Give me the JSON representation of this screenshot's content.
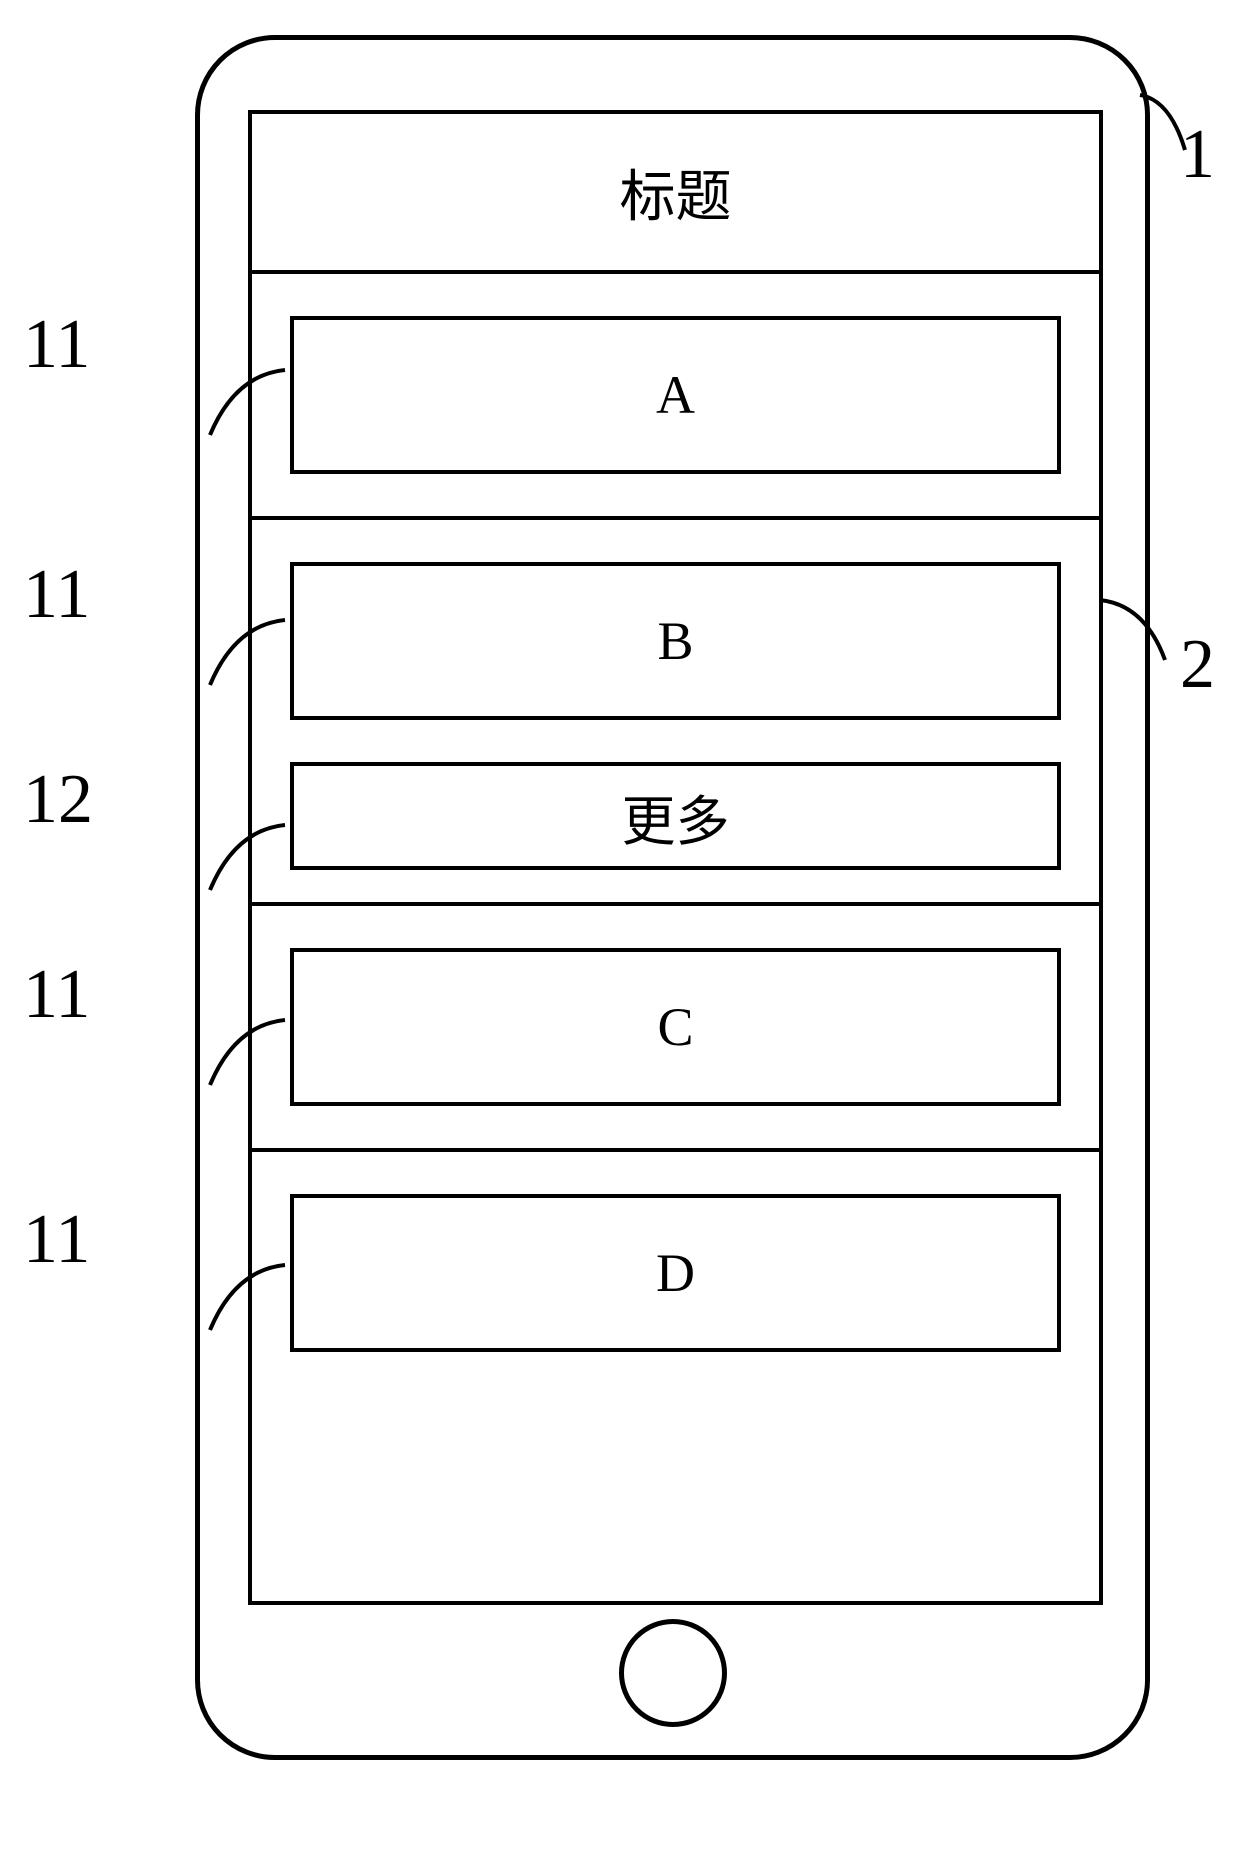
{
  "title": "标题",
  "items": {
    "a": "A",
    "b": "B",
    "c": "C",
    "d": "D"
  },
  "more_label": "更多",
  "callouts": {
    "phone": "1",
    "screen": "2",
    "item_a": "11",
    "item_b": "11",
    "more": "12",
    "item_c": "11",
    "item_d": "11"
  }
}
